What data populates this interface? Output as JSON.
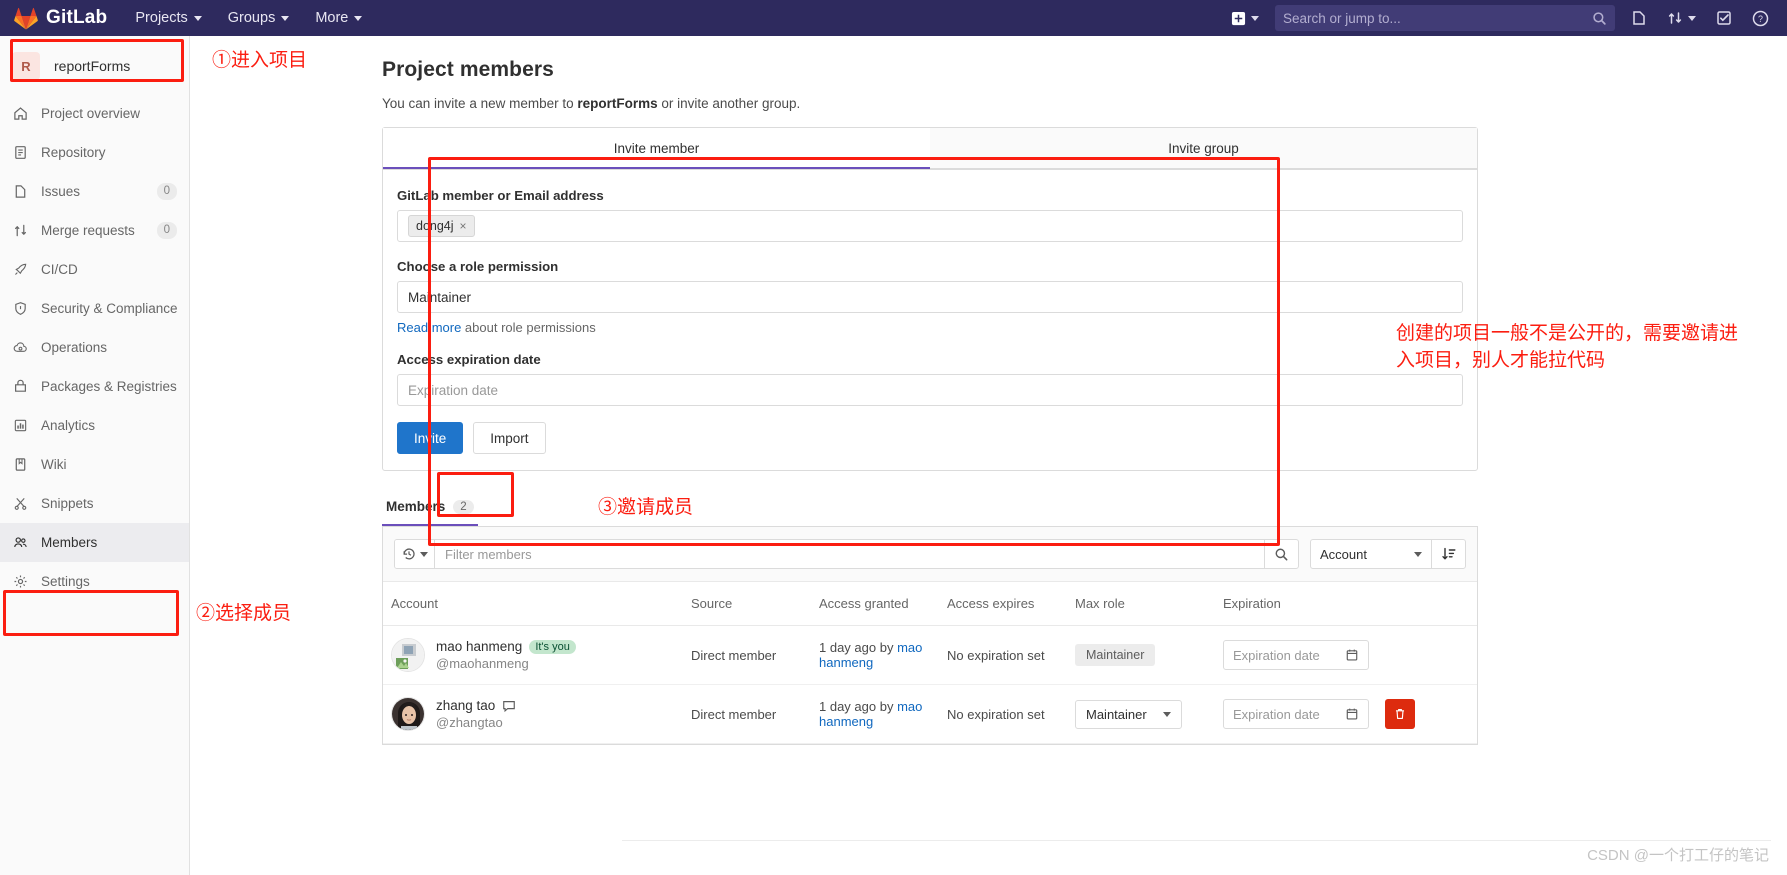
{
  "topnav": {
    "brand": "GitLab",
    "items": [
      {
        "label": "Projects",
        "icon": "chevron-down-icon"
      },
      {
        "label": "Groups",
        "icon": "chevron-down-icon"
      },
      {
        "label": "More",
        "icon": "chevron-down-icon"
      }
    ],
    "search": {
      "placeholder": "Search or jump to...",
      "value": ""
    },
    "right_icons": [
      "plus-square-icon",
      "chevron-down-icon",
      "issues-icon",
      "merge-request-icon",
      "chevron-down-icon",
      "todos-icon",
      "help-icon"
    ]
  },
  "sidebar": {
    "project": {
      "initial": "R",
      "name": "reportForms"
    },
    "items": [
      {
        "label": "Project overview",
        "icon": "home-icon",
        "badge": ""
      },
      {
        "label": "Repository",
        "icon": "document-icon",
        "badge": ""
      },
      {
        "label": "Issues",
        "icon": "issues-icon",
        "badge": "0"
      },
      {
        "label": "Merge requests",
        "icon": "merge-request-icon",
        "badge": "0"
      },
      {
        "label": "CI/CD",
        "icon": "rocket-icon",
        "badge": ""
      },
      {
        "label": "Security & Compliance",
        "icon": "shield-icon",
        "badge": ""
      },
      {
        "label": "Operations",
        "icon": "cloud-gear-icon",
        "badge": ""
      },
      {
        "label": "Packages & Registries",
        "icon": "package-icon",
        "badge": ""
      },
      {
        "label": "Analytics",
        "icon": "chart-bar-icon",
        "badge": ""
      },
      {
        "label": "Wiki",
        "icon": "book-icon",
        "badge": ""
      },
      {
        "label": "Snippets",
        "icon": "scissors-icon",
        "badge": ""
      },
      {
        "label": "Members",
        "icon": "users-icon",
        "badge": ""
      },
      {
        "label": "Settings",
        "icon": "gear-icon",
        "badge": ""
      }
    ]
  },
  "main": {
    "title": "Project members",
    "subtitle_pre": "You can invite a new member to ",
    "subtitle_project": "reportForms",
    "subtitle_post": " or invite another group.",
    "invite_card": {
      "tabs": [
        {
          "label": "Invite member",
          "active": true
        },
        {
          "label": "Invite group",
          "active": false
        }
      ],
      "member_field": {
        "label": "GitLab member or Email address",
        "token": "dong4j",
        "token_remove": "×"
      },
      "role_field": {
        "label": "Choose a role permission",
        "value": "Maintainer",
        "helper_link": "Read more",
        "helper_rest": " about role permissions"
      },
      "expiration_field": {
        "label": "Access expiration date",
        "placeholder": "Expiration date"
      },
      "buttons": {
        "invite": "Invite",
        "import": "Import"
      }
    },
    "members_section": {
      "tab_label": "Members",
      "tab_count": "2",
      "filter": {
        "placeholder": "Filter members",
        "value": "",
        "history_icon": "history-icon",
        "search_icon": "search-icon",
        "sort_value": "Account",
        "sort_direction_icon": "sort-descending-icon"
      },
      "columns": [
        "Account",
        "Source",
        "Access granted",
        "Access expires",
        "Max role",
        "Expiration"
      ],
      "rows": [
        {
          "name": "mao hanmeng",
          "badge": "It's you",
          "handle": "@maohanmeng",
          "has_comment_icon": false,
          "source": "Direct member",
          "granted_prefix": "1 day ago by ",
          "granted_by": "mao hanmeng",
          "expires": "No expiration set",
          "max_role": "Maintainer",
          "max_role_is_dropdown": false,
          "expiration_placeholder": "Expiration date",
          "has_delete": false
        },
        {
          "name": "zhang tao",
          "badge": "",
          "handle": "@zhangtao",
          "has_comment_icon": true,
          "source": "Direct member",
          "granted_prefix": "1 day ago by ",
          "granted_by": "mao hanmeng",
          "expires": "No expiration set",
          "max_role": "Maintainer",
          "max_role_is_dropdown": true,
          "expiration_placeholder": "Expiration date",
          "has_delete": true
        }
      ]
    }
  },
  "annotations": {
    "step1": "①进入项目",
    "step2": "②选择成员",
    "step3": "③邀请成员",
    "note": "创建的项目一般不是公开的，需要邀请进\n入项目，别人才能拉代码",
    "color": "#fb1d10"
  },
  "watermark": "CSDN @一个打工仔的笔记"
}
